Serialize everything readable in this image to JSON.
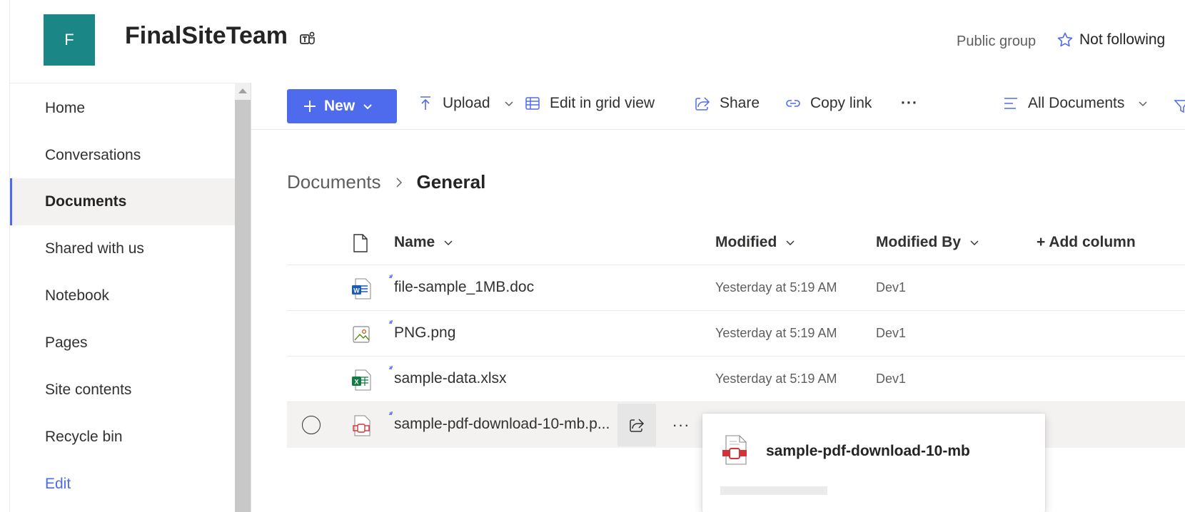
{
  "site": {
    "logo_letter": "F",
    "title": "FinalSiteTeam",
    "group_type": "Public group",
    "follow_label": "Not following"
  },
  "nav": {
    "items": [
      {
        "label": "Home"
      },
      {
        "label": "Conversations"
      },
      {
        "label": "Documents",
        "selected": true
      },
      {
        "label": "Shared with us"
      },
      {
        "label": "Notebook"
      },
      {
        "label": "Pages"
      },
      {
        "label": "Site contents"
      },
      {
        "label": "Recycle bin"
      }
    ],
    "edit_label": "Edit"
  },
  "toolbar": {
    "new_label": "New",
    "upload_label": "Upload",
    "edit_grid_label": "Edit in grid view",
    "share_label": "Share",
    "copy_link_label": "Copy link",
    "more_label": "···",
    "view_label": "All Documents"
  },
  "breadcrumb": {
    "parent": "Documents",
    "separator": ">",
    "current": "General"
  },
  "table": {
    "columns": {
      "name": "Name",
      "modified": "Modified",
      "modified_by": "Modified By",
      "add_column": "+ Add column"
    },
    "rows": [
      {
        "name": "file-sample_1MB.doc",
        "modified": "Yesterday at 5:19 AM",
        "modified_by": "Dev1",
        "icon": "word-doc-icon"
      },
      {
        "name": "PNG.png",
        "modified": "Yesterday at 5:19 AM",
        "modified_by": "Dev1",
        "icon": "image-file-icon"
      },
      {
        "name": "sample-data.xlsx",
        "modified": "Yesterday at 5:19 AM",
        "modified_by": "Dev1",
        "icon": "excel-file-icon"
      },
      {
        "name": "sample-pdf-download-10-mb.p...",
        "modified": "",
        "modified_by": "",
        "icon": "pdf-file-icon"
      }
    ]
  },
  "hover_card": {
    "title": "sample-pdf-download-10-mb"
  },
  "colors": {
    "accent": "#4f6bed",
    "logo_bg": "#1a8686",
    "pdf_red": "#d13438",
    "word_blue": "#185abd",
    "excel_green": "#107c41"
  }
}
